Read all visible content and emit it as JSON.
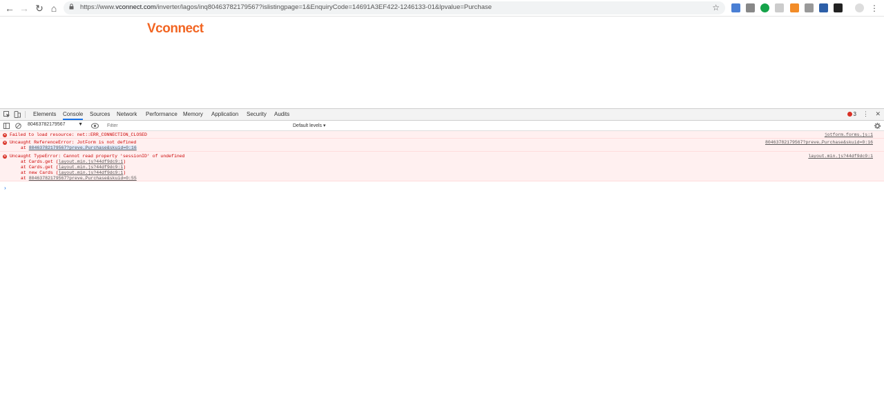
{
  "browser": {
    "url_prefix": "https://www.",
    "url_host": "vconnect.com",
    "url_path": "/inverter/lagos/inq80463782179567?islistingpage=1&EnquiryCode=14691A3EF422-1246133-01&lpvalue=Purchase"
  },
  "page": {
    "logo": "Vconnect"
  },
  "devtools": {
    "tabs": [
      "Elements",
      "Console",
      "Sources",
      "Network",
      "Performance",
      "Memory",
      "Application",
      "Security",
      "Audits"
    ],
    "active_tab": "Console",
    "error_count": "3",
    "context": "80463782179567",
    "filter_placeholder": "Filter",
    "levels": "Default levels ▾",
    "messages": [
      {
        "text": "Failed to load resource: net::ERR_CONNECTION_CLOSED",
        "source": "jotform.forms.js:1",
        "stack": []
      },
      {
        "text": "Uncaught ReferenceError: JotForm is not defined",
        "source": "80463782179567?preve…Purchase&skuid=0:16",
        "stack": [
          {
            "prefix": "at ",
            "link": "80463782179567?preve…Purchase&skuid=0:16"
          }
        ]
      },
      {
        "text": "Uncaught TypeError: Cannot read property 'sessionID' of undefined",
        "source": "layout.min.js?44df9dc9:1",
        "stack": [
          {
            "prefix": "at Cards.get (",
            "link": "layout.min.js?44df9dc9:1",
            "suffix": ")"
          },
          {
            "prefix": "at Cards.get (",
            "link": "layout.min.js?44df9dc9:1",
            "suffix": ")"
          },
          {
            "prefix": "at new Cards (",
            "link": "layout.min.js?44df9dc9:1",
            "suffix": ")"
          },
          {
            "prefix": "at ",
            "link": "80463782179567?preve…Purchase&skuid=0:55",
            "suffix": ""
          }
        ]
      }
    ],
    "prompt": "›"
  }
}
